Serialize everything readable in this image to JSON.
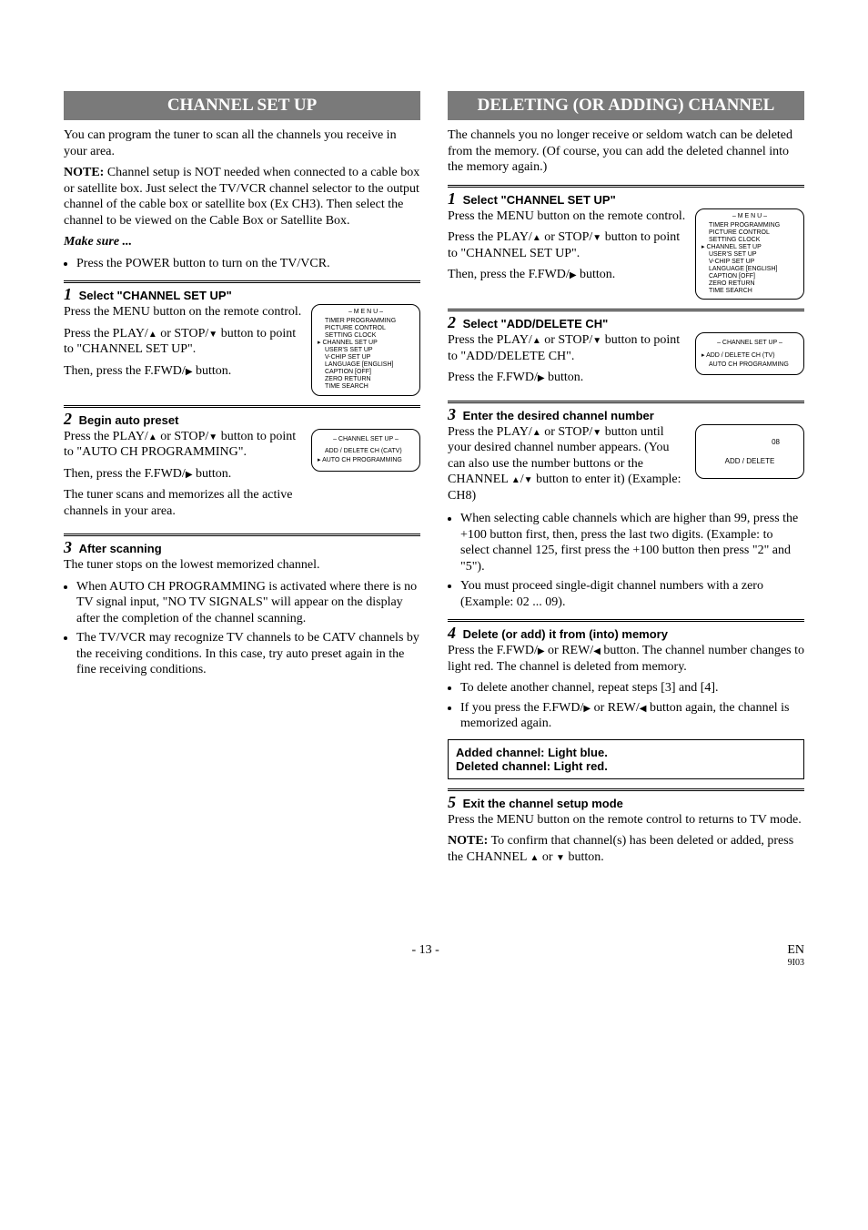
{
  "left": {
    "band": "CHANNEL SET UP",
    "intro": "You can program the tuner to scan all the channels you receive in your area.",
    "note_label": "NOTE:",
    "note_body": " Channel setup is NOT needed when connected to a cable box or satellite box. Just select the TV/VCR channel selector to the output channel of the cable box or satellite box (Ex CH3). Then select the channel to be viewed on the Cable Box or Satellite Box.",
    "makesure": "Make sure ...",
    "makesure_item": "Press the POWER button to turn on the TV/VCR.",
    "step1": {
      "num": "1",
      "label": "Select \"CHANNEL SET UP\"",
      "p1": "Press the MENU button on the remote control.",
      "p2a": "Press the PLAY/",
      "p2b": " or STOP/",
      "p2c": " button to point to \"CHANNEL SET UP\".",
      "p3a": "Then, press the F.FWD/",
      "p3b": " button."
    },
    "step2": {
      "num": "2",
      "label": "Begin auto preset",
      "p1a": "Press the PLAY/",
      "p1b": " or STOP/",
      "p1c": " button to point to \"AUTO CH PROGRAMMING\".",
      "p2a": "Then, press the F.FWD/",
      "p2b": " button.",
      "p3": "The tuner scans and memorizes all the active channels in your area."
    },
    "step3": {
      "num": "3",
      "label": "After scanning",
      "p1": "The tuner stops on the lowest memorized channel.",
      "b1": "When AUTO CH PROGRAMMING is activated where there is no TV signal input, \"NO TV SIGNALS\" will appear on the display after the completion of the channel scanning.",
      "b2": "The TV/VCR may recognize TV channels to be CATV channels by the receiving conditions. In this case, try auto preset again in the fine receiving conditions."
    }
  },
  "right": {
    "band": "DELETING (OR ADDING) CHANNEL",
    "intro": "The channels you no longer receive or seldom watch can be deleted from the memory. (Of course, you can add the deleted channel into the memory again.)",
    "step1": {
      "num": "1",
      "label": "Select \"CHANNEL SET UP\"",
      "p1": "Press the MENU button on the remote control.",
      "p2a": "Press the PLAY/",
      "p2b": " or STOP/",
      "p2c": " button to point to \"CHANNEL SET UP\".",
      "p3a": "Then, press the F.FWD/",
      "p3b": " button."
    },
    "step2": {
      "num": "2",
      "label": "Select \"ADD/DELETE CH\"",
      "p1a": "Press the PLAY/",
      "p1b": " or STOP/",
      "p1c": " button to point to \"ADD/DELETE CH\".",
      "p2a": "Press the F.FWD/",
      "p2b": " button."
    },
    "step3": {
      "num": "3",
      "label": "Enter the desired channel number",
      "p1a": "Press the PLAY/",
      "p1b": " or STOP/",
      "p1c": " button until your desired channel number appears. (You can also use the number buttons  or the CHANNEL ",
      "p1d": "/",
      "p1e": " button to enter it) (Example: CH8)",
      "b1": "When selecting cable channels which are higher than 99, press the +100 button first, then, press the last two digits. (Example: to select channel 125, first press the +100 button then press \"2\" and \"5\").",
      "b2": "You must proceed single-digit channel numbers with a zero (Example: 02 ...  09)."
    },
    "step4": {
      "num": "4",
      "label": "Delete (or add) it from (into) memory",
      "p1a": "Press the F.FWD/",
      "p1b": " or REW/",
      "p1c": " button. The channel number changes to light red. The channel is deleted from memory.",
      "b1": "To delete another channel, repeat steps [3] and [4].",
      "b2a": "If you press the F.FWD/",
      "b2b": " or REW/",
      "b2c": " button again, the channel is memorized again."
    },
    "added_box_l1": "Added channel: Light blue.",
    "added_box_l2": "Deleted channel: Light red.",
    "step5": {
      "num": "5",
      "label": "Exit the channel setup mode",
      "p1": "Press the MENU button on the remote control to returns to TV mode.",
      "note_label": "NOTE:",
      "note_a": " To confirm that channel(s) has been deleted or added, press the CHANNEL ",
      "note_b": " or ",
      "note_c": " button."
    }
  },
  "menu": {
    "title": "– M E N U –",
    "items": [
      "TIMER PROGRAMMING",
      "PICTURE CONTROL",
      "SETTING CLOCK",
      "CHANNEL SET UP",
      "USER'S SET UP",
      "V-CHIP SET UP",
      "LANGUAGE   [ENGLISH]",
      "CAPTION   [OFF]",
      "ZERO RETURN",
      "TIME SEARCH"
    ],
    "selected_index": 3
  },
  "chanset_catv": {
    "title": "– CHANNEL SET UP –",
    "line1": "ADD / DELETE CH (CATV)",
    "line2": "AUTO CH PROGRAMMING"
  },
  "chanset_tv": {
    "title": "– CHANNEL SET UP –",
    "line1": "ADD / DELETE CH (TV)",
    "line2": "AUTO CH PROGRAMMING"
  },
  "display": {
    "num": "08",
    "label": "ADD / DELETE"
  },
  "footer": {
    "page": "- 13 -",
    "lang": "EN",
    "code": "9I03"
  }
}
